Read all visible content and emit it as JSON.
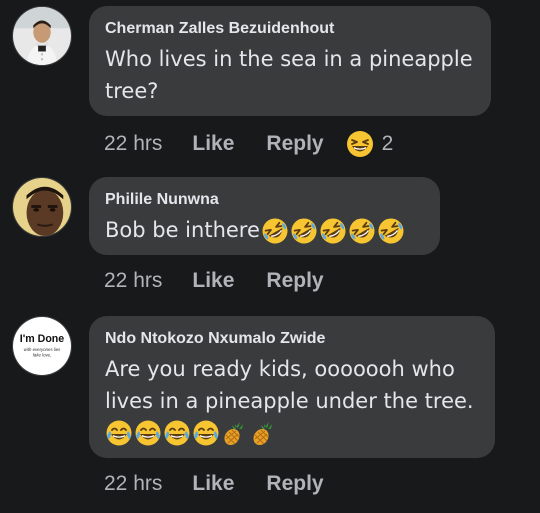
{
  "comments": [
    {
      "author": "Cherman Zalles Bezuidenhout",
      "text": "Who lives in the sea in a pineapple tree?",
      "time": "22 hrs",
      "like_label": "Like",
      "reply_label": "Reply",
      "reaction_icon": "grinning-squinting-face-icon",
      "reaction_count": "2"
    },
    {
      "author": "Philile Nunwna",
      "text": "Bob be inthere",
      "emojis": [
        "rolling-on-floor-laughing-icon",
        "rolling-on-floor-laughing-icon",
        "rolling-on-floor-laughing-icon",
        "rolling-on-floor-laughing-icon",
        "rolling-on-floor-laughing-icon"
      ],
      "time": "22 hrs",
      "like_label": "Like",
      "reply_label": "Reply"
    },
    {
      "author": "Ndo Ntokozo Nxumalo Zwide",
      "text": "Are you ready kids, ooooooh who lives in a pineapple under the tree.",
      "emojis": [
        "tears-of-joy-icon",
        "tears-of-joy-icon",
        "tears-of-joy-icon",
        "tears-of-joy-icon",
        "pineapple-icon",
        "pineapple-icon"
      ],
      "avatar_text": {
        "main": "I'm Done",
        "sub1": "with everyones lies",
        "sub2": "fake love,"
      },
      "time": "22 hrs",
      "like_label": "Like",
      "reply_label": "Reply"
    }
  ],
  "colors": {
    "background": "#18191a",
    "bubble": "#3a3b3c",
    "text": "#e4e6eb",
    "secondary_text": "#b0b3b8",
    "emoji_yellow": "#f7c531"
  }
}
